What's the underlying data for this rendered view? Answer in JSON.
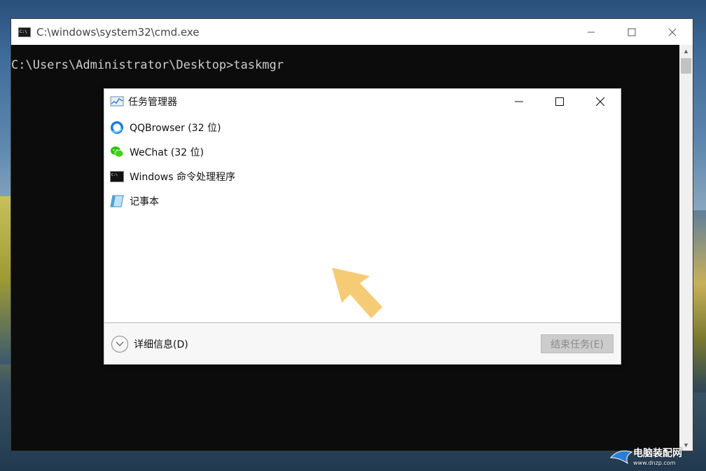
{
  "cmd": {
    "title": "C:\\windows\\system32\\cmd.exe",
    "line": "C:\\Users\\Administrator\\Desktop>taskmgr",
    "controls": {
      "minimize": "—",
      "maximize": "☐",
      "close": "✕"
    }
  },
  "task_manager": {
    "title": "任务管理器",
    "items": [
      {
        "label": "QQBrowser (32 位)",
        "icon": "qqbrowser-icon"
      },
      {
        "label": "WeChat (32 位)",
        "icon": "wechat-icon"
      },
      {
        "label": "Windows 命令处理程序",
        "icon": "cmd-icon"
      },
      {
        "label": "记事本",
        "icon": "notepad-icon"
      }
    ],
    "details_label": "详细信息(D)",
    "end_task_label": "结束任务(E)",
    "colors": {
      "accent": "#1e7bd6",
      "wechat": "#2dc100",
      "arrow": "#f5c76a"
    }
  },
  "watermark": {
    "text": "电脑装配网",
    "url": "www.dnzp.com"
  }
}
